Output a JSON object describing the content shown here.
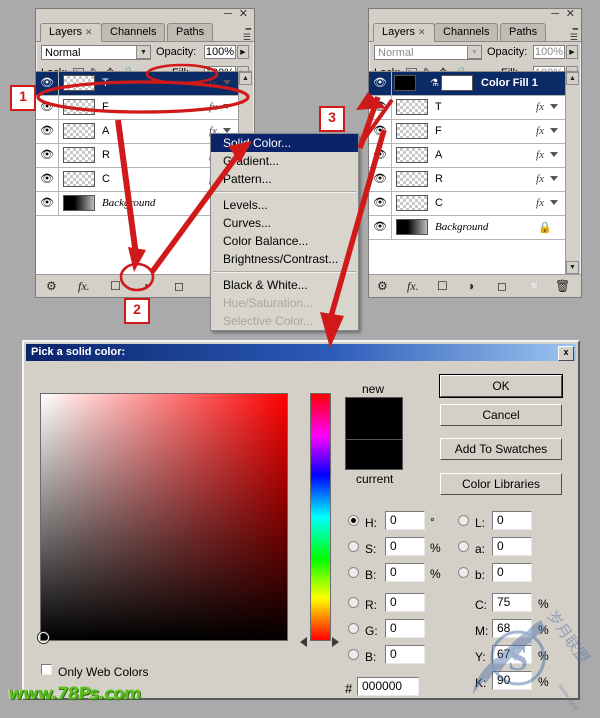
{
  "app": "Adobe Photoshop — Layers panel tutorial screenshot",
  "left_panel": {
    "tabs": [
      {
        "label": "Layers",
        "closable": true,
        "active": true
      },
      {
        "label": "Channels",
        "closable": false,
        "active": false
      },
      {
        "label": "Paths",
        "closable": false,
        "active": false
      }
    ],
    "blend_mode": "Normal",
    "opacity_label": "Opacity:",
    "opacity_value": "100%",
    "lock_label": "Lock:",
    "fill_label": "Fill:",
    "fill_value": "100%",
    "layers": [
      {
        "name": "T",
        "selected": true,
        "thumb": "transparent",
        "fx": true,
        "locked": false
      },
      {
        "name": "F",
        "selected": false,
        "thumb": "transparent",
        "fx": true,
        "locked": false
      },
      {
        "name": "A",
        "selected": false,
        "thumb": "transparent",
        "fx": true,
        "locked": false
      },
      {
        "name": "R",
        "selected": false,
        "thumb": "transparent",
        "fx": true,
        "locked": false
      },
      {
        "name": "C",
        "selected": false,
        "thumb": "transparent",
        "fx": true,
        "locked": false
      },
      {
        "name": "Background",
        "selected": false,
        "thumb": "gradient",
        "fx": false,
        "locked": true
      }
    ],
    "footer_icons": [
      "link-icon",
      "fx-icon",
      "layer-mask-icon",
      "adjustment-layer-icon",
      "new-group-icon",
      "new-layer-icon"
    ]
  },
  "right_panel": {
    "tabs": [
      {
        "label": "Layers",
        "closable": true,
        "active": true
      },
      {
        "label": "Channels",
        "closable": false,
        "active": false
      },
      {
        "label": "Paths",
        "closable": false,
        "active": false
      }
    ],
    "blend_mode": "Normal",
    "opacity_label": "Opacity:",
    "opacity_value": "100%",
    "lock_label": "Lock:",
    "fill_label": "Fill:",
    "fill_value": "100%",
    "layers": [
      {
        "name": "Color Fill 1",
        "selected": true,
        "thumb": "solid-black",
        "mask": true,
        "fx": false,
        "locked": false
      },
      {
        "name": "T",
        "selected": false,
        "thumb": "transparent",
        "fx": true,
        "locked": false
      },
      {
        "name": "F",
        "selected": false,
        "thumb": "transparent",
        "fx": true,
        "locked": false
      },
      {
        "name": "A",
        "selected": false,
        "thumb": "transparent",
        "fx": true,
        "locked": false
      },
      {
        "name": "R",
        "selected": false,
        "thumb": "transparent",
        "fx": true,
        "locked": false
      },
      {
        "name": "C",
        "selected": false,
        "thumb": "transparent",
        "fx": true,
        "locked": false
      },
      {
        "name": "Background",
        "selected": false,
        "thumb": "gradient",
        "fx": false,
        "locked": true
      }
    ],
    "footer_icons": [
      "link-icon",
      "fx-icon",
      "layer-mask-icon",
      "adjustment-layer-icon",
      "new-group-icon",
      "new-layer-icon",
      "delete-layer-icon"
    ]
  },
  "context_menu": {
    "items": [
      {
        "label": "Solid Color...",
        "highlighted": true,
        "disabled": false,
        "separator_after": false
      },
      {
        "label": "Gradient...",
        "highlighted": false,
        "disabled": false,
        "separator_after": false
      },
      {
        "label": "Pattern...",
        "highlighted": false,
        "disabled": false,
        "separator_after": true
      },
      {
        "label": "Levels...",
        "highlighted": false,
        "disabled": false,
        "separator_after": false
      },
      {
        "label": "Curves...",
        "highlighted": false,
        "disabled": false,
        "separator_after": false
      },
      {
        "label": "Color Balance...",
        "highlighted": false,
        "disabled": false,
        "separator_after": false
      },
      {
        "label": "Brightness/Contrast...",
        "highlighted": false,
        "disabled": false,
        "separator_after": true
      },
      {
        "label": "Black & White...",
        "highlighted": false,
        "disabled": false,
        "separator_after": false
      },
      {
        "label": "Hue/Saturation...",
        "highlighted": false,
        "disabled": true,
        "separator_after": false
      },
      {
        "label": "Selective Color...",
        "highlighted": false,
        "disabled": true,
        "separator_after": false
      }
    ]
  },
  "dialog": {
    "title": "Pick a solid color:",
    "close_label": "x",
    "new_label": "new",
    "current_label": "current",
    "new_color": "#000000",
    "current_color": "#000000",
    "buttons": [
      {
        "label": "OK",
        "default": true
      },
      {
        "label": "Cancel",
        "default": false
      },
      {
        "label": "Add To Swatches",
        "default": false
      },
      {
        "label": "Color Libraries",
        "default": false
      }
    ],
    "only_web_colors_label": "Only Web Colors",
    "only_web_colors_checked": false,
    "hex_prefix": "#",
    "hex_value": "000000",
    "hsb": [
      {
        "key": "H:",
        "value": "0",
        "unit": "°",
        "selected": true
      },
      {
        "key": "S:",
        "value": "0",
        "unit": "%",
        "selected": false
      },
      {
        "key": "B:",
        "value": "0",
        "unit": "%",
        "selected": false
      }
    ],
    "rgb": [
      {
        "key": "R:",
        "value": "0",
        "unit": "",
        "selected": false
      },
      {
        "key": "G:",
        "value": "0",
        "unit": "",
        "selected": false
      },
      {
        "key": "B:",
        "value": "0",
        "unit": "",
        "selected": false
      }
    ],
    "lab": [
      {
        "key": "L:",
        "value": "0",
        "unit": "",
        "selected": false
      },
      {
        "key": "a:",
        "value": "0",
        "unit": "",
        "selected": false
      },
      {
        "key": "b:",
        "value": "0",
        "unit": "",
        "selected": false
      }
    ],
    "cmyk": [
      {
        "key": "C:",
        "value": "75",
        "unit": "%"
      },
      {
        "key": "M:",
        "value": "68",
        "unit": "%"
      },
      {
        "key": "Y:",
        "value": "67",
        "unit": "%"
      },
      {
        "key": "K:",
        "value": "90",
        "unit": "%"
      }
    ]
  },
  "annotations": {
    "accent_color": "#d01a1a",
    "markers": [
      {
        "label": "1"
      },
      {
        "label": "2"
      },
      {
        "label": "3"
      }
    ]
  },
  "watermarks": {
    "bottom_left": "www.78Ps.com",
    "bottom_right_letter": "S",
    "bottom_right_text": "岁月联盟",
    "bottom_right_url": "www.syue.com"
  }
}
